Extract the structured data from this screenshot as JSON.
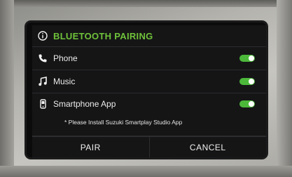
{
  "dialog": {
    "title": "BLUETOOTH PAIRING",
    "title_icon": "info-icon",
    "accent_color": "#6fc23a",
    "items": [
      {
        "icon": "phone-icon",
        "label": "Phone",
        "toggle_on": true
      },
      {
        "icon": "music-icon",
        "label": "Music",
        "toggle_on": true
      },
      {
        "icon": "smartphone-icon",
        "label": "Smartphone App",
        "toggle_on": true
      }
    ],
    "note": "* Please Install Suzuki Smartplay Studio App",
    "buttons": {
      "pair": "PAIR",
      "cancel": "CANCEL"
    }
  }
}
